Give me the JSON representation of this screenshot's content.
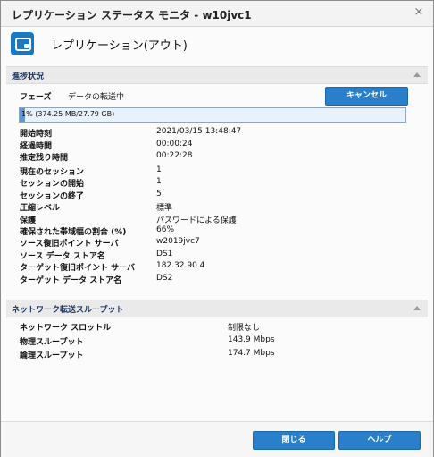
{
  "window": {
    "title": "レプリケーション ステータス モニタ - w10jvc1",
    "close_glyph": "×"
  },
  "header": {
    "icon": "replication-icon",
    "title": "レプリケーション(アウト)"
  },
  "progress_section": {
    "heading": "進捗状況",
    "phase_label": "フェーズ",
    "phase_value": "データの転送中",
    "cancel_label": "キャンセル",
    "progress_text": "1% (374.25 MB/27.79 GB)",
    "progress_fraction": 0.013,
    "time_rows": [
      {
        "label": "開始時刻",
        "value": "2021/03/15 13:48:47"
      },
      {
        "label": "経過時間",
        "value": "00:00:24"
      },
      {
        "label": "推定残り時間",
        "value": "00:22:28"
      }
    ],
    "session_rows": [
      {
        "label": "現在のセッション",
        "value": "1"
      },
      {
        "label": "セッションの開始",
        "value": "1"
      },
      {
        "label": "セッションの終了",
        "value": "5"
      },
      {
        "label": "圧縮レベル",
        "value": "標準"
      },
      {
        "label": "保護",
        "value": "パスワードによる保護"
      },
      {
        "label": "確保された帯域幅の割合 (%)",
        "value": "66%"
      },
      {
        "label": "ソース復旧ポイント サーバ",
        "value": "w2019jvc7"
      },
      {
        "label": "ソース データ ストア名",
        "value": "DS1"
      },
      {
        "label": "ターゲット復旧ポイント サーバ",
        "value": "182.32.90.4"
      },
      {
        "label": "ターゲット データ ストア名",
        "value": "DS2"
      }
    ]
  },
  "throughput_section": {
    "heading": "ネットワーク転送スループット",
    "rows": [
      {
        "label": "ネットワーク スロットル",
        "value": "制限なし"
      },
      {
        "label": "物理スループット",
        "value": "143.9 Mbps"
      },
      {
        "label": "論理スループット",
        "value": "174.7 Mbps"
      }
    ]
  },
  "footer": {
    "close_label": "閉じる",
    "help_label": "ヘルプ"
  }
}
